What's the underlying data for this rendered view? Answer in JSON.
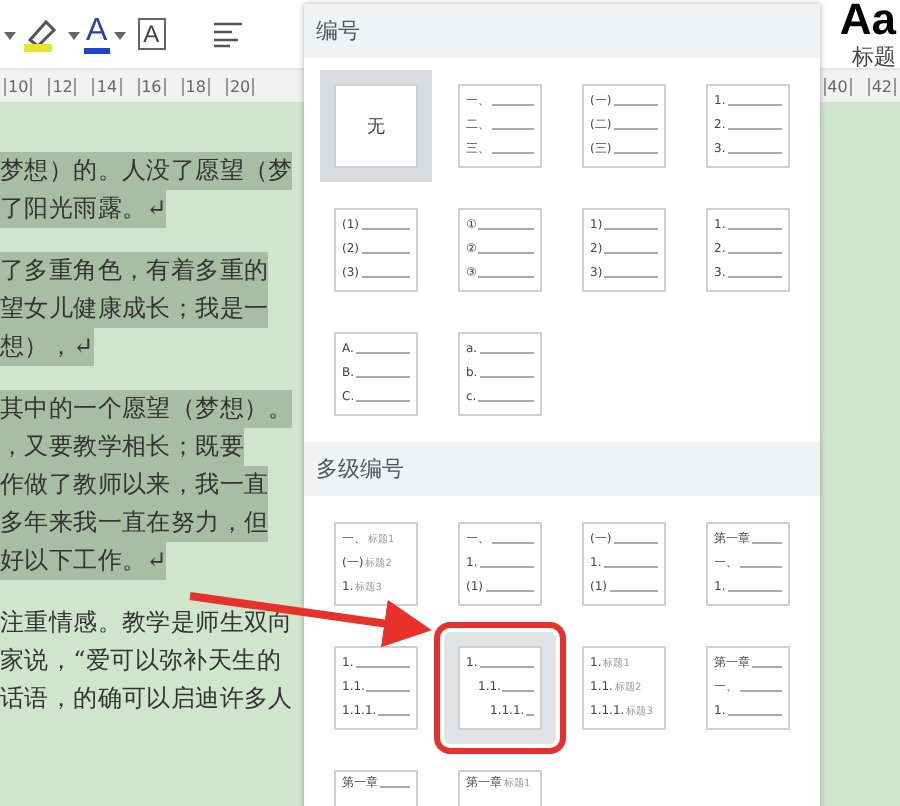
{
  "toolbar": {
    "font_color_glyph": "A",
    "char_border_glyph": "A",
    "style_preview": "Aa",
    "style_name": "标题"
  },
  "ruler": {
    "left_ticks": [
      "10",
      "12",
      "14",
      "16",
      "18",
      "20"
    ],
    "right_ticks": [
      "40",
      "42"
    ]
  },
  "document": {
    "paragraphs": [
      {
        "lines": [
          {
            "text": "梦想）的。人没了愿望（梦",
            "selected": true
          },
          {
            "text": "了阳光雨露。↵",
            "selected": true
          }
        ]
      },
      {
        "lines": [
          {
            "text": "了多重角色，有着多重的",
            "selected": true
          },
          {
            "text": "望女儿健康成长；我是一",
            "selected": true
          },
          {
            "text": "想），↵",
            "selected": true
          }
        ]
      },
      {
        "lines": [
          {
            "text": "其中的一个愿望（梦想）。",
            "selected": true
          },
          {
            "text": "，又要教学相长；既要",
            "selected": true
          },
          {
            "text": "作做了教师以来，我一直",
            "selected": true
          },
          {
            "text": "多年来我一直在努力，但",
            "selected": true
          },
          {
            "text": "好以下工作。↵",
            "selected": true
          }
        ]
      },
      {
        "lines": [
          {
            "text": "注重情感。教学是师生双向",
            "selected": false
          },
          {
            "text": "家说，“爱可以弥补天生的",
            "selected": false
          },
          {
            "text": "话语，的确可以启迪许多人",
            "selected": false
          }
        ]
      }
    ]
  },
  "numbering_panel": {
    "title": "编号",
    "options": [
      {
        "kind": "none",
        "label": "无",
        "selected": true
      },
      {
        "kind": "list",
        "selected": false,
        "lines": [
          "一、",
          "二、",
          "三、"
        ]
      },
      {
        "kind": "list",
        "selected": false,
        "lines": [
          "(一)",
          "(二)",
          "(三)"
        ]
      },
      {
        "kind": "list",
        "selected": false,
        "lines": [
          "1.",
          "2.",
          "3."
        ]
      },
      {
        "kind": "list",
        "selected": false,
        "lines": [
          "(1)",
          "(2)",
          "(3)"
        ]
      },
      {
        "kind": "list",
        "selected": false,
        "lines": [
          "①",
          "②",
          "③"
        ]
      },
      {
        "kind": "list",
        "selected": false,
        "lines": [
          "1)",
          "2)",
          "3)"
        ]
      },
      {
        "kind": "list",
        "selected": false,
        "lines": [
          "1.",
          "2.",
          "3."
        ]
      },
      {
        "kind": "list",
        "selected": false,
        "lines": [
          "A.",
          "B.",
          "C."
        ]
      },
      {
        "kind": "list",
        "selected": false,
        "lines": [
          "a.",
          "b.",
          "c."
        ]
      }
    ],
    "multilevel_title": "多级编号",
    "multilevel_options": [
      {
        "kind": "flat",
        "callout": false,
        "lines": [
          {
            "prefix": "一、",
            "label": "标题1"
          },
          {
            "prefix": "(一)",
            "label": "标题2"
          },
          {
            "prefix": "1.",
            "label": "标题3"
          }
        ]
      },
      {
        "kind": "flat",
        "callout": false,
        "lines": [
          {
            "prefix": "一、"
          },
          {
            "prefix": "1."
          },
          {
            "prefix": "(1)"
          }
        ]
      },
      {
        "kind": "flat",
        "callout": false,
        "lines": [
          {
            "prefix": "(一)"
          },
          {
            "prefix": "1."
          },
          {
            "prefix": "(1)"
          }
        ]
      },
      {
        "kind": "flat",
        "callout": false,
        "lines": [
          {
            "prefix": "第一章"
          },
          {
            "prefix": "一、"
          },
          {
            "prefix": "1."
          }
        ]
      },
      {
        "kind": "flat",
        "callout": false,
        "lines": [
          {
            "prefix": "1."
          },
          {
            "prefix": "1.1."
          },
          {
            "prefix": "1.1.1."
          }
        ]
      },
      {
        "kind": "stepped",
        "callout": true,
        "lines": [
          {
            "prefix": "1."
          },
          {
            "prefix": "1.1."
          },
          {
            "prefix": "1.1.1."
          }
        ]
      },
      {
        "kind": "flat",
        "callout": false,
        "lines": [
          {
            "prefix": "1.",
            "label": "标题1"
          },
          {
            "prefix": "1.1.",
            "label": "标题2"
          },
          {
            "prefix": "1.1.1.",
            "label": "标题3"
          }
        ]
      },
      {
        "kind": "flat",
        "callout": false,
        "lines": [
          {
            "prefix": "第一章"
          },
          {
            "prefix": "一、"
          },
          {
            "prefix": "1."
          }
        ]
      },
      {
        "kind": "flat",
        "callout": false,
        "lines": [
          {
            "prefix": "第一章"
          }
        ]
      },
      {
        "kind": "flat",
        "callout": false,
        "lines": [
          {
            "prefix": "第一章",
            "label": "标题1"
          }
        ]
      }
    ]
  }
}
